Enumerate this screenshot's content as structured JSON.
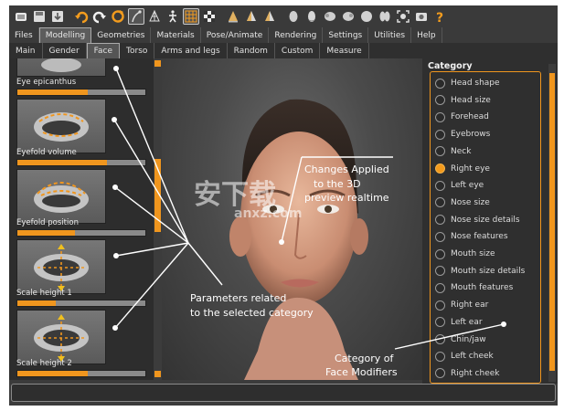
{
  "toolbar": {
    "icons": [
      "new-file-icon",
      "save-icon",
      "export-icon",
      "undo-icon",
      "redo-icon",
      "reset-icon",
      "pose-tool-icon",
      "wireframe-icon",
      "skeleton-icon",
      "grid-icon",
      "checker-icon",
      "front-view-icon",
      "side-view-icon",
      "back-view-icon",
      "face-front-icon",
      "face-side-icon",
      "head-left-icon",
      "head-right-icon",
      "head-top-icon",
      "head-bottom-icon",
      "reset-camera-icon",
      "screenshot-icon",
      "help-icon"
    ]
  },
  "menu_tabs": [
    "Files",
    "Modelling",
    "Geometries",
    "Materials",
    "Pose/Animate",
    "Rendering",
    "Settings",
    "Utilities",
    "Help"
  ],
  "menu_active": "Modelling",
  "sub_tabs": [
    "Main",
    "Gender",
    "Face",
    "Torso",
    "Arms and legs",
    "Random",
    "Custom",
    "Measure"
  ],
  "sub_active": "Face",
  "parameters": [
    {
      "label": "Eye epicanthus",
      "value": 0.55
    },
    {
      "label": "Eyefold volume",
      "value": 0.7
    },
    {
      "label": "Eyefold position",
      "value": 0.45
    },
    {
      "label": "Scale height 1",
      "value": 0.3
    },
    {
      "label": "Scale height 2",
      "value": 0.55
    }
  ],
  "category": {
    "title": "Category",
    "items": [
      "Head shape",
      "Head size",
      "Forehead",
      "Eyebrows",
      "Neck",
      "Right eye",
      "Left eye",
      "Nose size",
      "Nose size details",
      "Nose features",
      "Mouth size",
      "Mouth size details",
      "Mouth features",
      "Right ear",
      "Left ear",
      "Chin/jaw",
      "Left cheek",
      "Right cheek"
    ],
    "selected": "Right eye"
  },
  "annotations": {
    "viewport_note_line1": "Changes Applied",
    "viewport_note_line2": "to the 3D",
    "viewport_note_line3": "preview realtime",
    "params_note_line1": "Parameters related",
    "params_note_line2": "to  the selected category",
    "category_note_line1": "Category of",
    "category_note_line2": "Face Modifiers"
  },
  "watermark": {
    "text_cn": "安下载",
    "text_en": "anxz.com"
  },
  "colors": {
    "accent": "#f0961e",
    "panel": "#2d2d2d",
    "toolbar": "#3a3a3a"
  }
}
